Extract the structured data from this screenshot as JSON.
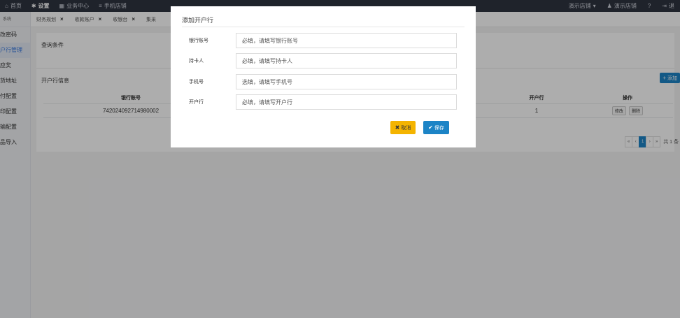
{
  "topnav": {
    "items": [
      {
        "icon": "home-icon",
        "glyph": "⌂",
        "label": "首页"
      },
      {
        "icon": "gear-icon",
        "glyph": "✱",
        "label": "设置"
      },
      {
        "icon": "grid-icon",
        "glyph": "▦",
        "label": "业务中心"
      },
      {
        "icon": "list-icon",
        "glyph": "≡",
        "label": "手机店铺"
      }
    ],
    "right": [
      {
        "label": "演示店铺",
        "glyph": "▾"
      },
      {
        "icon": "user-icon",
        "glyph": "♟",
        "label": "演示店铺"
      },
      {
        "icon": "help-icon",
        "glyph": "?"
      },
      {
        "icon": "logout-icon",
        "glyph": "⇥",
        "label": "退"
      }
    ]
  },
  "sidebar": {
    "header": "系统",
    "items": [
      {
        "label": "改密码",
        "active": false
      },
      {
        "label": "户行管理",
        "active": true
      },
      {
        "label": "应奖",
        "active": false
      },
      {
        "label": "货地址",
        "active": false
      },
      {
        "label": "付配置",
        "active": false
      },
      {
        "label": "印配置",
        "active": false
      },
      {
        "label": "输配置",
        "active": false
      },
      {
        "label": "品导入",
        "active": false
      }
    ]
  },
  "tabs": [
    {
      "label": "财务规划"
    },
    {
      "label": "收款账户"
    },
    {
      "label": "收银台"
    },
    {
      "label": "集采"
    }
  ],
  "query_panel": {
    "title": "查询条件"
  },
  "list_panel": {
    "title": "开户行信息",
    "add_label": "添加",
    "columns": [
      "银行账号",
      "开户行",
      "操作"
    ],
    "rows": [
      {
        "account": "742024092714980002",
        "bank": "1",
        "edit": "修改",
        "delete": "删除"
      }
    ],
    "pager": {
      "first": "«",
      "prev": "‹",
      "current": "1",
      "next": "›",
      "last": "»",
      "total": "共 1 条"
    }
  },
  "modal": {
    "title": "添加开户行",
    "fields": [
      {
        "label": "银行账号",
        "placeholder": "必填，请填写银行账号"
      },
      {
        "label": "持卡人",
        "placeholder": "必填，请填写持卡人"
      },
      {
        "label": "手机号",
        "placeholder": "选填，请填写手机号"
      },
      {
        "label": "开户行",
        "placeholder": "必填，请填写开户行"
      }
    ],
    "cancel_label": "取消",
    "save_label": "保存"
  },
  "colors": {
    "primary": "#1c84c6",
    "warning": "#f4b400",
    "topbar": "#2f3440"
  }
}
